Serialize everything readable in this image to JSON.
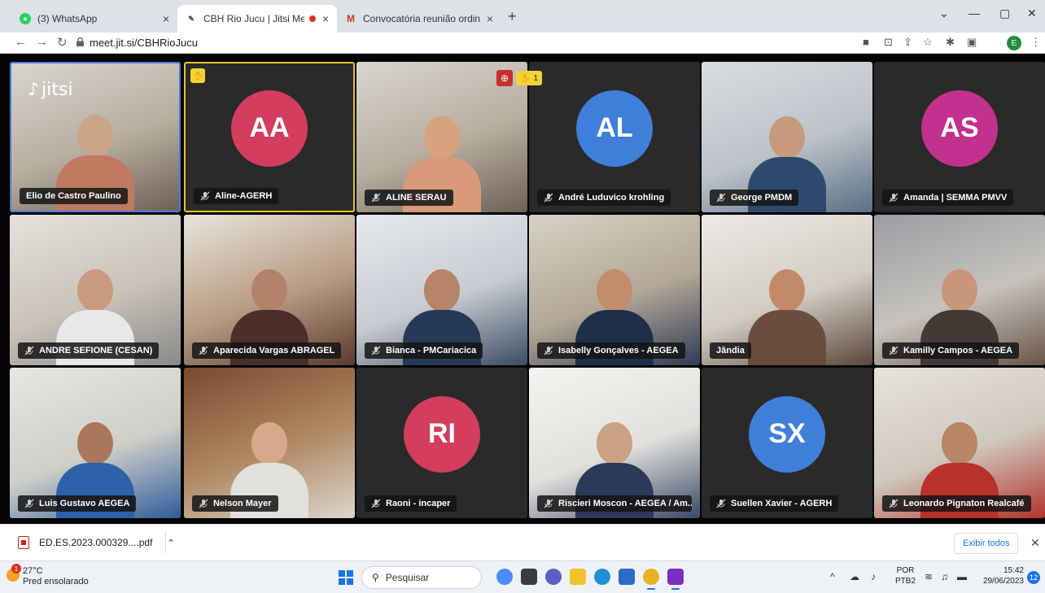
{
  "browser": {
    "tabs": [
      {
        "label": "(3) WhatsApp",
        "active": false
      },
      {
        "label": "CBH Rio Jucu | Jitsi Meet",
        "active": true
      },
      {
        "label": "Convocatória reunião ordinária d",
        "active": false
      }
    ],
    "url": "meet.jit.si/CBHRioJucu",
    "profile_initial": "E",
    "tab_icons": [
      "whatsapp-icon",
      "jitsi-icon",
      "gmail-icon"
    ]
  },
  "meeting": {
    "watermark": "jitsi",
    "raised_hand_count": "1",
    "participants": [
      {
        "name": "Elio de Castro Paulino",
        "type": "video",
        "muted": false,
        "dominant": true
      },
      {
        "name": "Aline-AGERH",
        "type": "avatar",
        "initials": "AA",
        "color": "#d33d5e",
        "muted": true,
        "raised_hand": true
      },
      {
        "name": "ALINE SERAU",
        "type": "video",
        "muted": true
      },
      {
        "name": "André Luduvico krohling",
        "type": "avatar",
        "initials": "AL",
        "color": "#3f7fd9",
        "muted": true
      },
      {
        "name": "George PMDM",
        "type": "video",
        "muted": true
      },
      {
        "name": "Amanda | SEMMA PMVV",
        "type": "avatar",
        "initials": "AS",
        "color": "#c3318f",
        "muted": true
      },
      {
        "name": "ANDRE SEFIONE (CESAN)",
        "type": "video",
        "muted": true
      },
      {
        "name": "Aparecida Vargas ABRAGEL",
        "type": "video",
        "muted": true
      },
      {
        "name": "Bianca - PMCariacica",
        "type": "video",
        "muted": true
      },
      {
        "name": "Isabelly Gonçalves - AEGEA",
        "type": "video",
        "muted": true
      },
      {
        "name": "Jândia",
        "type": "video",
        "muted": false
      },
      {
        "name": "Kamilly Campos - AEGEA",
        "type": "video",
        "muted": true
      },
      {
        "name": "Luis Gustavo AEGEA",
        "type": "video",
        "muted": true
      },
      {
        "name": "Nelson Mayer",
        "type": "video",
        "muted": true
      },
      {
        "name": "Raoni - incaper",
        "type": "avatar",
        "initials": "RI",
        "color": "#d33d5e",
        "muted": true
      },
      {
        "name": "Riscieri Moscon - AEGEA / Am...",
        "type": "video",
        "muted": true
      },
      {
        "name": "Suellen Xavier - AGERH",
        "type": "avatar",
        "initials": "SX",
        "color": "#3f7fd9",
        "muted": true
      },
      {
        "name": "Leonardo Pignaton Realcafé",
        "type": "video",
        "muted": true
      }
    ]
  },
  "downloads": {
    "file": "ED.ES.2023.000329....pdf",
    "show_all": "Exibir todos"
  },
  "taskbar": {
    "weather_temp": "27°C",
    "weather_desc": "Pred ensolarado",
    "weather_badge": "1",
    "search_placeholder": "Pesquisar",
    "lang_1": "POR",
    "lang_2": "PTB2",
    "time": "15:42",
    "date": "29/06/2023",
    "notif_count": "12"
  }
}
